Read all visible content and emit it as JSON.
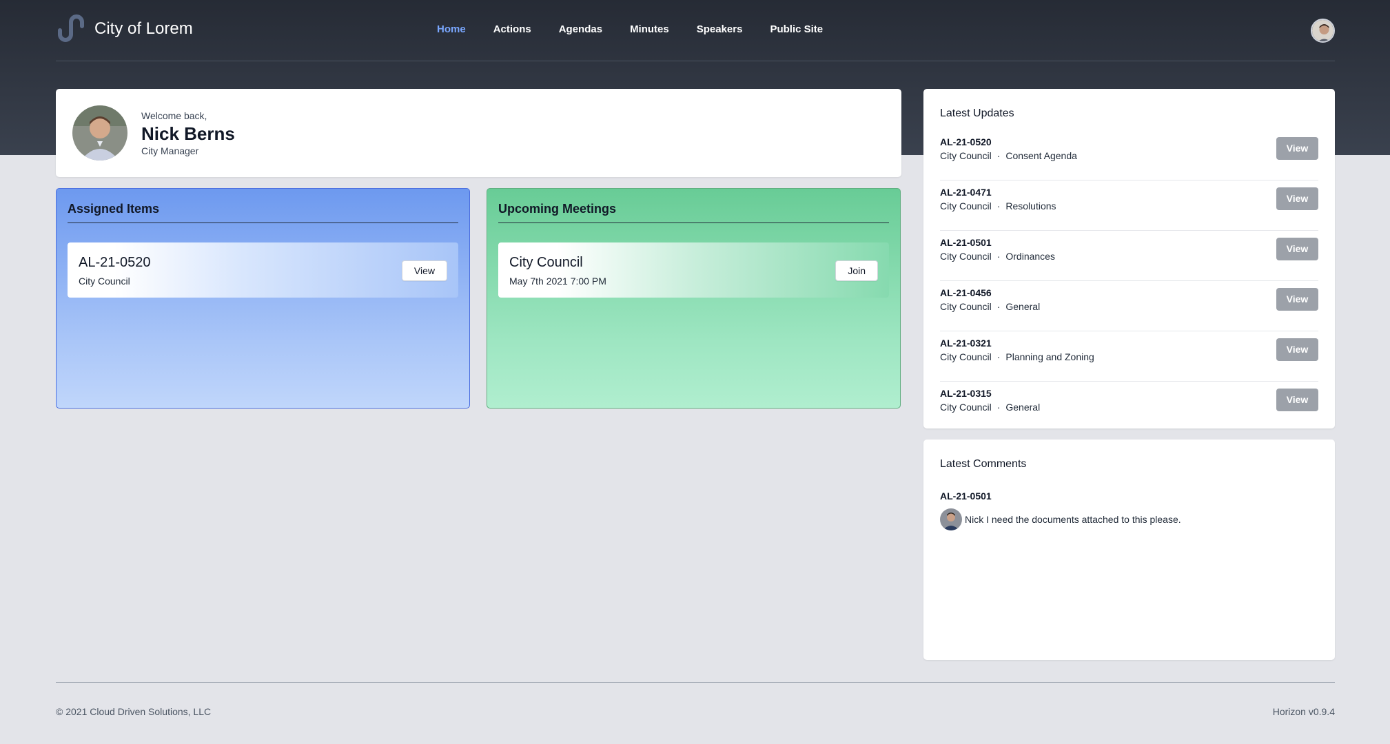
{
  "brand": {
    "name": "City of Lorem",
    "logo_icon": "brand-logo-icon"
  },
  "nav": [
    {
      "label": "Home",
      "active": true
    },
    {
      "label": "Actions",
      "active": false
    },
    {
      "label": "Agendas",
      "active": false
    },
    {
      "label": "Minutes",
      "active": false
    },
    {
      "label": "Speakers",
      "active": false
    },
    {
      "label": "Public Site",
      "active": false
    }
  ],
  "welcome": {
    "greeting": "Welcome back,",
    "name": "Nick Berns",
    "role": "City Manager"
  },
  "assigned": {
    "heading": "Assigned Items",
    "items": [
      {
        "title": "AL-21-0520",
        "subtitle": "City Council",
        "button": "View"
      }
    ]
  },
  "meetings": {
    "heading": "Upcoming Meetings",
    "items": [
      {
        "title": "City Council",
        "subtitle": "May 7th 2021 7:00 PM",
        "button": "Join"
      }
    ]
  },
  "updates": {
    "heading": "Latest Updates",
    "button": "View",
    "separator": "·",
    "rows": [
      {
        "code": "AL-21-0520",
        "body": "City Council",
        "category": "Consent Agenda"
      },
      {
        "code": "AL-21-0471",
        "body": "City Council",
        "category": "Resolutions"
      },
      {
        "code": "AL-21-0501",
        "body": "City Council",
        "category": "Ordinances"
      },
      {
        "code": "AL-21-0456",
        "body": "City Council",
        "category": "General"
      },
      {
        "code": "AL-21-0321",
        "body": "City Council",
        "category": "Planning and Zoning"
      },
      {
        "code": "AL-21-0315",
        "body": "City Council",
        "category": "General"
      }
    ]
  },
  "comments": {
    "heading": "Latest Comments",
    "items": [
      {
        "code": "AL-21-0501",
        "text": "Nick I need the documents attached to this please."
      }
    ]
  },
  "footer": {
    "copyright": "© 2021 Cloud Driven Solutions, LLC",
    "version": "Horizon v0.9.4"
  },
  "colors": {
    "header_dark": "#262b35",
    "nav_active": "#7aa7ff",
    "assigned_panel": "#6d99ef",
    "meetings_panel": "#68cc96",
    "view_button": "#9ca1a9",
    "page_bg": "#e3e4e9"
  }
}
